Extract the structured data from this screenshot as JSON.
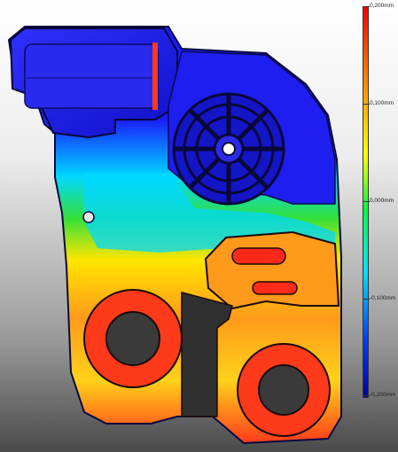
{
  "legend": {
    "ticks": [
      "0,200mm",
      "0,100mm",
      "0,000mm",
      "-0,100mm",
      "-0,200mm"
    ]
  },
  "colors": {
    "blue": "#1a1aff",
    "cyan": "#00d8ff",
    "green": "#33e03a",
    "yellow": "#ffe600",
    "orange": "#ff7a1a",
    "red": "#ff2a1a"
  }
}
